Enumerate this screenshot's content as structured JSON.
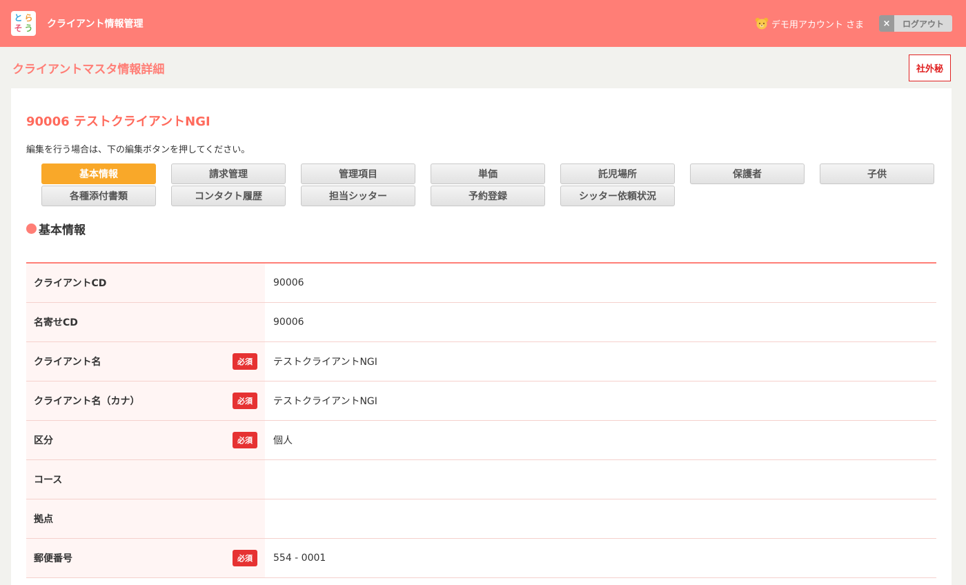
{
  "header": {
    "logo": [
      "と",
      "ら",
      "そ",
      "う"
    ],
    "app_title": "クライアント情報管理",
    "account": "デモ用アカウント さま",
    "logout_x": "×",
    "logout_label": "ログアウト"
  },
  "subheader": {
    "page_title": "クライアントマスタ情報詳細",
    "confidential": "社外秘"
  },
  "client": {
    "title": "90006 テストクライアントNGI",
    "instruction": "編集を行う場合は、下の編集ボタンを押してください。"
  },
  "tabs": [
    {
      "label": "基本情報",
      "active": true
    },
    {
      "label": "請求管理"
    },
    {
      "label": "管理項目"
    },
    {
      "label": "単価"
    },
    {
      "label": "託児場所"
    },
    {
      "label": "保護者"
    },
    {
      "label": "子供"
    },
    {
      "label": "各種添付書類"
    },
    {
      "label": "コンタクト履歴"
    },
    {
      "label": "担当シッター"
    },
    {
      "label": "予約登録"
    },
    {
      "label": "シッター依頼状況"
    }
  ],
  "section": {
    "title": "基本情報"
  },
  "required_label": "必須",
  "rows": [
    {
      "label": "クライアントCD",
      "value": "90006",
      "required": false
    },
    {
      "label": "名寄せCD",
      "value": "90006",
      "required": false
    },
    {
      "label": "クライアント名",
      "value": "テストクライアントNGI",
      "required": true
    },
    {
      "label": "クライアント名（カナ）",
      "value": "テストクライアントNGI",
      "required": true
    },
    {
      "label": "区分",
      "value": "個人",
      "required": true
    },
    {
      "label": "コース",
      "value": "",
      "required": false
    },
    {
      "label": "拠点",
      "value": "",
      "required": false
    },
    {
      "label": "郵便番号",
      "value": "554 - 0001",
      "required": true
    }
  ],
  "colors": {
    "header": "#ff7e76",
    "active_tab": "#f9a829",
    "required": "#e63232",
    "accent_text": "#ff6a5c"
  }
}
